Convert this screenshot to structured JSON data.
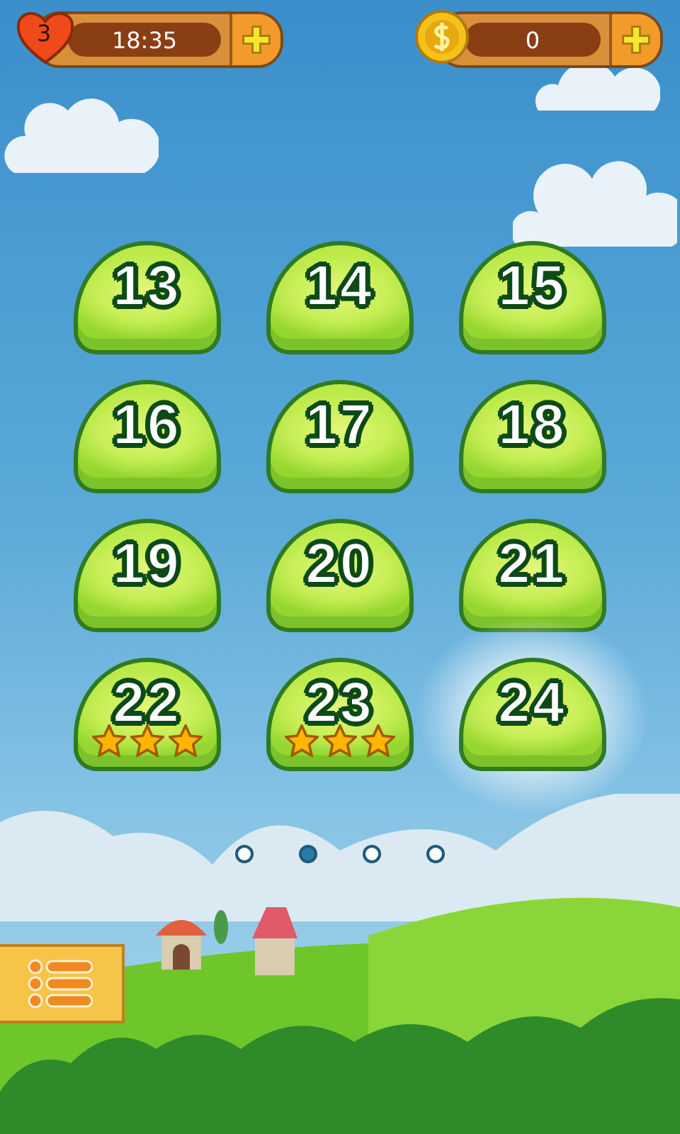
{
  "lives": {
    "count": "3",
    "timer": "18:35"
  },
  "coins": {
    "amount": "0"
  },
  "levels": [
    {
      "number": "13",
      "current": false
    },
    {
      "number": "14",
      "current": false
    },
    {
      "number": "15",
      "current": false
    },
    {
      "number": "16",
      "current": false
    },
    {
      "number": "17",
      "current": false
    },
    {
      "number": "18",
      "current": false
    },
    {
      "number": "19",
      "current": false
    },
    {
      "number": "20",
      "current": false
    },
    {
      "number": "21",
      "current": false
    },
    {
      "number": "22",
      "stars": 3,
      "current": false
    },
    {
      "number": "23",
      "stars": 3,
      "current": false
    },
    {
      "number": "24",
      "current": true
    }
  ],
  "pages": [
    {
      "selected": false
    },
    {
      "selected": true
    },
    {
      "selected": false
    },
    {
      "selected": false
    }
  ]
}
